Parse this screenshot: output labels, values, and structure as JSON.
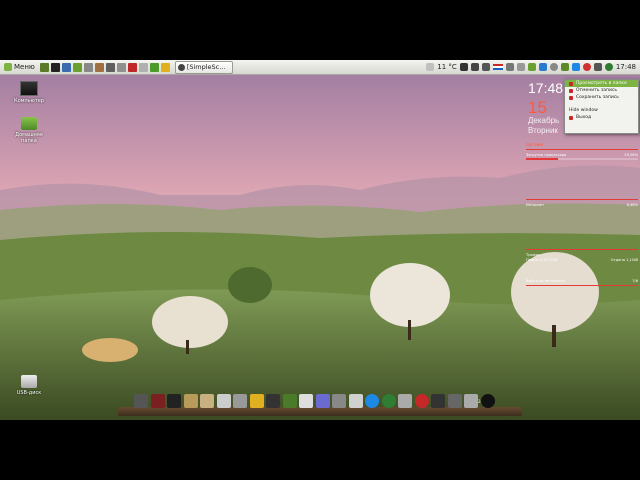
{
  "top_panel": {
    "menu_label": "Меню",
    "task_window_title": "[SimpleSc...",
    "tray": {
      "temperature": "11 °C",
      "time": "17:48"
    }
  },
  "desktop": {
    "icons": [
      {
        "label": "Компьютер",
        "icon": "computer-icon"
      },
      {
        "label": "Домашняя папка",
        "icon": "home-folder-icon"
      },
      {
        "label": "USB-диск",
        "icon": "usb-drive-icon"
      }
    ]
  },
  "clock_widget": {
    "time": "17:48",
    "day": "15",
    "month": "Декабрь",
    "weekday": "Вторник"
  },
  "popup_menu": {
    "items": [
      {
        "label": "Просмотреть в папке",
        "selected": true
      },
      {
        "label": "Отменить запись",
        "selected": false
      },
      {
        "label": "Сохранить запись",
        "selected": false
      },
      {
        "label": "Hide window",
        "selected": false
      },
      {
        "label": "Выход",
        "selected": false
      }
    ]
  },
  "conky": {
    "header": "система",
    "processors_label": "Загрузка процессора",
    "processors_value": "29,26%",
    "net_label": "Интернет",
    "net_value": "8,48%",
    "traffic_label": "Трафик",
    "down_total": "Принято 24,7GiB",
    "up_total": "Отдано 1,1GiB",
    "offline_label": "Выйти из интернета",
    "offline_value": "7/6",
    "cpu_fraction": 0.29
  },
  "dock": {
    "icons": [
      "app-icon",
      "app-icon",
      "terminal-icon",
      "folder-icon",
      "folder-icon",
      "app-icon",
      "app-icon",
      "warning-icon",
      "app-icon",
      "image-icon",
      "app-icon",
      "cursor-icon",
      "app-icon",
      "clapper-icon",
      "skype-icon",
      "globe-icon",
      "app-icon",
      "record-icon",
      "app-icon",
      "search-icon",
      "app-icon",
      "power-icon"
    ],
    "battery_label": "24%"
  }
}
